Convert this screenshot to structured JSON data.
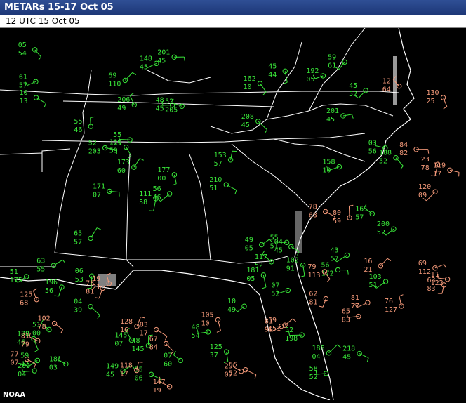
{
  "header": {
    "title": "METARs 15-17 Oct 05"
  },
  "subheader": {
    "valid_time": "12 UTC 15 Oct 05"
  },
  "credit": "NOAA",
  "colors": {
    "vfr": "#39e639",
    "ifr": "#f59a7a",
    "border": "#ffffff",
    "background": "#000000"
  },
  "icons": {
    "station": "station-circle-icon",
    "wind": "wind-barb-icon"
  },
  "stations_green": [
    [
      "218",
      "45"
    ],
    [
      "45",
      "52"
    ],
    [
      "208",
      "45"
    ],
    [
      "48",
      "45"
    ],
    [
      "196",
      "56"
    ],
    [
      "178",
      "46"
    ],
    [
      "52",
      "205"
    ],
    [
      "04",
      "45"
    ],
    [
      "201",
      "45"
    ],
    [
      "49",
      "05"
    ],
    [
      "56",
      "46"
    ],
    [
      "177",
      "00"
    ],
    [
      "45",
      "44"
    ],
    [
      "186",
      "04"
    ],
    [
      "55",
      "51"
    ],
    [
      "119",
      "59"
    ],
    [
      "181",
      "05"
    ],
    [
      "03",
      "56"
    ],
    [
      "59",
      "47"
    ],
    [
      "210",
      "51"
    ],
    [
      "201",
      "45"
    ],
    [
      "117",
      "52"
    ],
    [
      "04",
      "39"
    ],
    [
      "203",
      "04"
    ],
    [
      "192",
      "05"
    ],
    [
      "171",
      "07"
    ],
    [
      "55",
      "46"
    ],
    [
      "181",
      "03"
    ],
    [
      "148",
      "45"
    ],
    [
      "103",
      "51"
    ],
    [
      "145",
      "07"
    ],
    [
      "52",
      "203"
    ],
    [
      "05",
      "54"
    ],
    [
      "200",
      "52"
    ],
    [
      "48",
      "54"
    ],
    [
      "51",
      "00"
    ],
    [
      "43",
      "57"
    ],
    [
      "158",
      "10"
    ],
    [
      "52",
      "198"
    ],
    [
      "10",
      "49"
    ],
    [
      "161",
      "57"
    ],
    [
      "07",
      "52"
    ],
    [
      "56",
      "172"
    ],
    [
      "07",
      "60"
    ],
    [
      "162",
      "10"
    ],
    [
      "149",
      "45"
    ],
    [
      "188",
      "52"
    ],
    [
      "06",
      "53"
    ],
    [
      "153",
      "57"
    ],
    [
      "173",
      "60"
    ],
    [
      "61",
      "57"
    ],
    [
      "111",
      "58"
    ],
    [
      "51",
      "175"
    ],
    [
      "59",
      "61"
    ],
    [
      "55",
      "06"
    ],
    [
      "58",
      "52"
    ],
    [
      "206",
      "49"
    ],
    [
      "65",
      "57"
    ],
    [
      "48",
      "145"
    ],
    [
      "10",
      "13"
    ],
    [
      "125",
      "37"
    ],
    [
      "69",
      "110"
    ],
    [
      "102",
      "91"
    ],
    [
      "63",
      "55"
    ],
    [
      "55",
      "75"
    ]
  ],
  "stations_pink": [
    [
      "69",
      "112"
    ],
    [
      "11",
      "122"
    ],
    [
      "62",
      "81"
    ],
    [
      "23",
      "78"
    ],
    [
      "130",
      "25"
    ],
    [
      "119",
      "17"
    ],
    [
      "120",
      "09"
    ],
    [
      "79",
      "113"
    ],
    [
      "63",
      "83"
    ],
    [
      "16",
      "21"
    ],
    [
      "78",
      "68"
    ],
    [
      "76",
      "127"
    ],
    [
      "81",
      "77"
    ],
    [
      "12",
      "64"
    ],
    [
      "84",
      "82"
    ],
    [
      "80",
      "59"
    ],
    [
      "65",
      "83"
    ],
    [
      "19",
      "21"
    ],
    [
      "81",
      "99"
    ],
    [
      "67",
      "84"
    ],
    [
      "125",
      "68"
    ],
    [
      "81",
      "79"
    ],
    [
      "83",
      "17"
    ],
    [
      "78",
      "81"
    ],
    [
      "147",
      "19"
    ],
    [
      "118",
      "17"
    ],
    [
      "105",
      "10"
    ],
    [
      "102",
      "78"
    ],
    [
      "59",
      "151"
    ],
    [
      "77",
      "07"
    ],
    [
      "128",
      "16"
    ],
    [
      "66",
      "52"
    ],
    [
      "29",
      "07"
    ]
  ]
}
